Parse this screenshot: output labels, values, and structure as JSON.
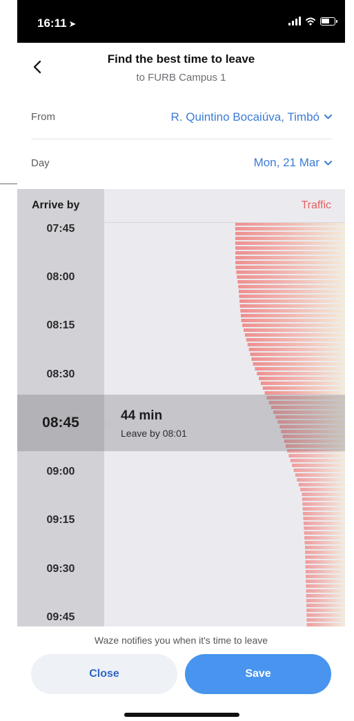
{
  "status_bar": {
    "time": "16:11",
    "location_icon": "location-arrow-icon"
  },
  "header": {
    "title": "Find the best time to leave",
    "subtitle": "to FURB Campus 1",
    "back_icon": "chevron-left-icon"
  },
  "from": {
    "label": "From",
    "value": "R. Quintino Bocaiúva, Timbó"
  },
  "day": {
    "label": "Day",
    "value": "Mon, 21 Mar"
  },
  "chart": {
    "arrive_label": "Arrive by",
    "traffic_label": "Traffic",
    "time_labels": [
      "07:45",
      "08:00",
      "08:15",
      "08:30",
      "09:00",
      "09:15",
      "09:30",
      "09:45"
    ],
    "selected": {
      "time": "08:45",
      "duration": "44 min",
      "leave_by": "Leave by 08:01"
    },
    "colors": {
      "traffic_red": "#e5605f",
      "traffic_fade": "#f3ead8"
    }
  },
  "footer": {
    "notice": "Waze notifies you when it's time to leave",
    "close_label": "Close",
    "save_label": "Save"
  }
}
